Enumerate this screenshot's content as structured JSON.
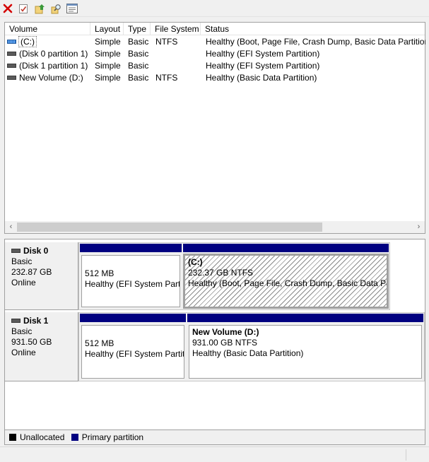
{
  "toolbar": {
    "buttons": [
      "cancel-icon",
      "checklist-icon",
      "folder-up-icon",
      "search-icon",
      "properties-icon"
    ]
  },
  "volume_list": {
    "columns": [
      "Volume",
      "Layout",
      "Type",
      "File System",
      "Status"
    ],
    "rows": [
      {
        "volume": "(C:)",
        "layout": "Simple",
        "type": "Basic",
        "fs": "NTFS",
        "status": "Healthy (Boot, Page File, Crash Dump, Basic Data Partition)"
      },
      {
        "volume": "(Disk 0 partition 1)",
        "layout": "Simple",
        "type": "Basic",
        "fs": "",
        "status": "Healthy (EFI System Partition)"
      },
      {
        "volume": "(Disk 1 partition 1)",
        "layout": "Simple",
        "type": "Basic",
        "fs": "",
        "status": "Healthy (EFI System Partition)"
      },
      {
        "volume": "New Volume (D:)",
        "layout": "Simple",
        "type": "Basic",
        "fs": "NTFS",
        "status": "Healthy (Basic Data Partition)"
      }
    ],
    "scroll_left": "‹",
    "scroll_right": "›"
  },
  "disks": [
    {
      "name": "Disk 0",
      "type": "Basic",
      "size": "232.87 GB",
      "state": "Online",
      "partitions": [
        {
          "name": "",
          "size": "512 MB",
          "status": "Healthy (EFI System Partition)"
        },
        {
          "name": "(C:)",
          "size": "232.37 GB NTFS",
          "status": "Healthy (Boot, Page File, Crash Dump, Basic Data Partition)"
        }
      ]
    },
    {
      "name": "Disk 1",
      "type": "Basic",
      "size": "931.50 GB",
      "state": "Online",
      "partitions": [
        {
          "name": "",
          "size": "512 MB",
          "status": "Healthy (EFI System Partition)"
        },
        {
          "name": "New Volume  (D:)",
          "size": "931.00 GB NTFS",
          "status": "Healthy (Basic Data Partition)"
        }
      ]
    }
  ],
  "legend": [
    {
      "label": "Unallocated",
      "color": "#000000"
    },
    {
      "label": "Primary partition",
      "color": "#000080"
    }
  ],
  "colors": {
    "primary_partition": "#000080",
    "delete": "#d40000"
  }
}
